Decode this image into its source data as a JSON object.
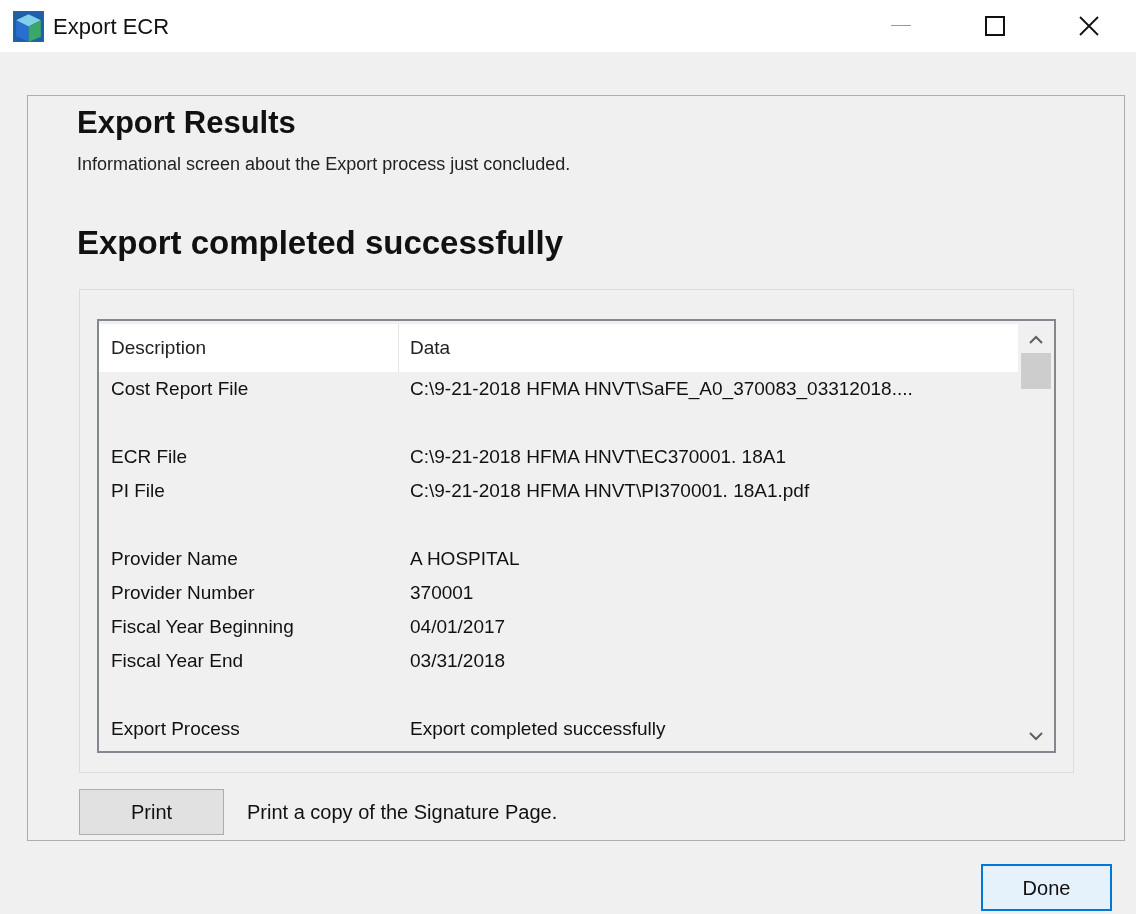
{
  "window": {
    "title": "Export ECR"
  },
  "heading": "Export Results",
  "subtitle": "Informational screen about the Export process just concluded.",
  "status": "Export completed successfully",
  "table": {
    "columns": [
      "Description",
      "Data"
    ],
    "groups": [
      [
        {
          "description": "Cost Report File",
          "data": "C:\\9-21-2018 HFMA HNVT\\SaFE_A0_370083_03312018...."
        }
      ],
      [
        {
          "description": "ECR File",
          "data": "C:\\9-21-2018 HFMA HNVT\\EC370001. 18A1"
        },
        {
          "description": "PI File",
          "data": "C:\\9-21-2018 HFMA HNVT\\PI370001. 18A1.pdf"
        }
      ],
      [
        {
          "description": "Provider Name",
          "data": "A HOSPITAL"
        },
        {
          "description": "Provider Number",
          "data": "370001"
        },
        {
          "description": "Fiscal Year Beginning",
          "data": "04/01/2017"
        },
        {
          "description": "Fiscal Year End",
          "data": "03/31/2018"
        }
      ],
      [
        {
          "description": "Export Process",
          "data": "Export completed successfully"
        }
      ]
    ]
  },
  "print": {
    "button": "Print",
    "note": "Print a copy of the Signature Page."
  },
  "done": {
    "label": "Done",
    "focused": true
  }
}
